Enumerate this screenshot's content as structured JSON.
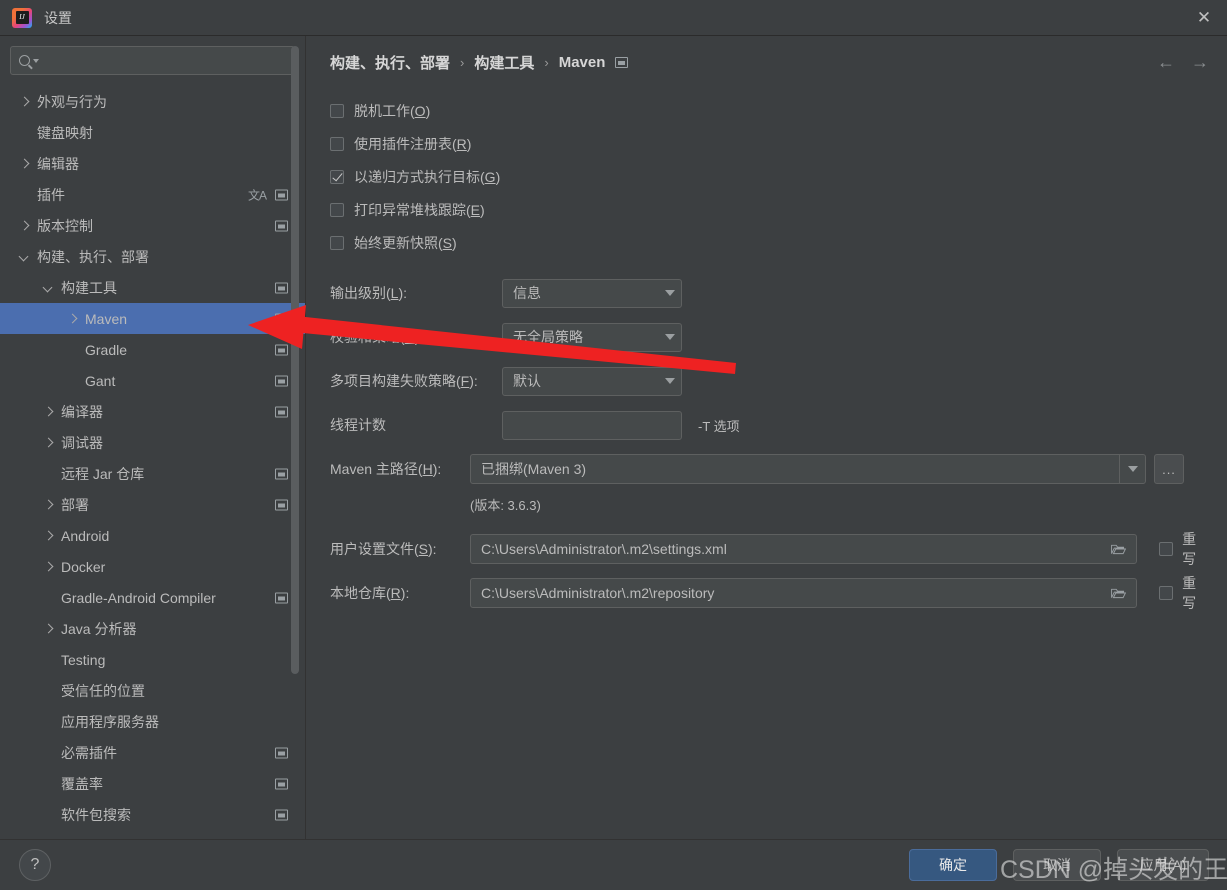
{
  "window": {
    "title": "设置",
    "app_icon": "intellij-idea-icon",
    "close_label": "✕"
  },
  "search": {
    "value": "",
    "placeholder": "",
    "icon": "search-icon",
    "dropdown_icon": "chevron-down-icon"
  },
  "sidebar": {
    "items": [
      {
        "label": "外观与行为",
        "indent": 0,
        "arrow": "closed",
        "project_icon": false,
        "lang_icon": false,
        "selected": false
      },
      {
        "label": "键盘映射",
        "indent": 0,
        "arrow": "none",
        "project_icon": false,
        "lang_icon": false,
        "selected": false
      },
      {
        "label": "编辑器",
        "indent": 0,
        "arrow": "closed",
        "project_icon": false,
        "lang_icon": false,
        "selected": false
      },
      {
        "label": "插件",
        "indent": 0,
        "arrow": "none",
        "project_icon": true,
        "lang_icon": true,
        "selected": false
      },
      {
        "label": "版本控制",
        "indent": 0,
        "arrow": "closed",
        "project_icon": true,
        "lang_icon": false,
        "selected": false
      },
      {
        "label": "构建、执行、部署",
        "indent": 0,
        "arrow": "open",
        "project_icon": false,
        "lang_icon": false,
        "selected": false
      },
      {
        "label": "构建工具",
        "indent": 1,
        "arrow": "open",
        "project_icon": true,
        "lang_icon": false,
        "selected": false
      },
      {
        "label": "Maven",
        "indent": 2,
        "arrow": "closed",
        "project_icon": true,
        "lang_icon": false,
        "selected": true
      },
      {
        "label": "Gradle",
        "indent": 2,
        "arrow": "none",
        "project_icon": true,
        "lang_icon": false,
        "selected": false
      },
      {
        "label": "Gant",
        "indent": 2,
        "arrow": "none",
        "project_icon": true,
        "lang_icon": false,
        "selected": false
      },
      {
        "label": "编译器",
        "indent": 1,
        "arrow": "closed",
        "project_icon": true,
        "lang_icon": false,
        "selected": false
      },
      {
        "label": "调试器",
        "indent": 1,
        "arrow": "closed",
        "project_icon": false,
        "lang_icon": false,
        "selected": false
      },
      {
        "label": "远程 Jar 仓库",
        "indent": 1,
        "arrow": "none",
        "project_icon": true,
        "lang_icon": false,
        "selected": false
      },
      {
        "label": "部署",
        "indent": 1,
        "arrow": "closed",
        "project_icon": true,
        "lang_icon": false,
        "selected": false
      },
      {
        "label": "Android",
        "indent": 1,
        "arrow": "closed",
        "project_icon": false,
        "lang_icon": false,
        "selected": false
      },
      {
        "label": "Docker",
        "indent": 1,
        "arrow": "closed",
        "project_icon": false,
        "lang_icon": false,
        "selected": false
      },
      {
        "label": "Gradle-Android Compiler",
        "indent": 1,
        "arrow": "none",
        "project_icon": true,
        "lang_icon": false,
        "selected": false
      },
      {
        "label": "Java 分析器",
        "indent": 1,
        "arrow": "closed",
        "project_icon": false,
        "lang_icon": false,
        "selected": false
      },
      {
        "label": "Testing",
        "indent": 1,
        "arrow": "none",
        "project_icon": false,
        "lang_icon": false,
        "selected": false
      },
      {
        "label": "受信任的位置",
        "indent": 1,
        "arrow": "none",
        "project_icon": false,
        "lang_icon": false,
        "selected": false
      },
      {
        "label": "应用程序服务器",
        "indent": 1,
        "arrow": "none",
        "project_icon": false,
        "lang_icon": false,
        "selected": false
      },
      {
        "label": "必需插件",
        "indent": 1,
        "arrow": "none",
        "project_icon": true,
        "lang_icon": false,
        "selected": false
      },
      {
        "label": "覆盖率",
        "indent": 1,
        "arrow": "none",
        "project_icon": true,
        "lang_icon": false,
        "selected": false
      },
      {
        "label": "软件包搜索",
        "indent": 1,
        "arrow": "none",
        "project_icon": true,
        "lang_icon": false,
        "selected": false
      }
    ]
  },
  "content": {
    "breadcrumb": [
      {
        "label": "构建、执行、部署"
      },
      {
        "label": "构建工具"
      },
      {
        "label": "Maven"
      }
    ],
    "breadcrumb_separator": "›",
    "breadcrumb_project_icon": "project-scope-icon",
    "nav_back": "←",
    "nav_forward": "→",
    "checkboxes": [
      {
        "label": "脱机工作(",
        "mnemonic": "O",
        "label_end": ")",
        "checked": false
      },
      {
        "label": "使用插件注册表(",
        "mnemonic": "R",
        "label_end": ")",
        "checked": false
      },
      {
        "label": "以递归方式执行目标(",
        "mnemonic": "G",
        "label_end": ")",
        "checked": true
      },
      {
        "label": "打印异常堆栈跟踪(",
        "mnemonic": "E",
        "label_end": ")",
        "checked": false
      },
      {
        "label": "始终更新快照(",
        "mnemonic": "S",
        "label_end": ")",
        "checked": false
      }
    ],
    "fields": [
      {
        "label": "输出级别(",
        "mnemonic": "L",
        "label_end": "):",
        "value": "信息",
        "kind": "combo"
      },
      {
        "label": "校验和策略(",
        "mnemonic": "C",
        "label_end": "):",
        "value": "无全局策略",
        "kind": "combo"
      },
      {
        "label": "多项目构建失败策略(",
        "mnemonic": "F",
        "label_end": "):",
        "value": "默认",
        "kind": "combo"
      },
      {
        "label": "线程计数",
        "mnemonic": "",
        "label_end": "",
        "value": "",
        "kind": "text",
        "hint": "-T 选项"
      }
    ],
    "maven_home": {
      "label": "Maven 主路径(",
      "mnemonic": "H",
      "label_end": "):",
      "value": "已捆绑(Maven 3)",
      "browse_label": "...",
      "version_note": "(版本: 3.6.3)"
    },
    "paths": [
      {
        "label": "用户设置文件(",
        "mnemonic": "S",
        "label_end": "):",
        "value": "C:\\Users\\Administrator\\.m2\\settings.xml",
        "browse_icon": "folder-icon",
        "override_label": "重写",
        "override_checked": false
      },
      {
        "label": "本地仓库(",
        "mnemonic": "R",
        "label_end": "):",
        "value": "C:\\Users\\Administrator\\.m2\\repository",
        "browse_icon": "folder-icon",
        "override_label": "重写",
        "override_checked": false
      }
    ]
  },
  "footer": {
    "help_label": "?",
    "ok_label": "确定",
    "cancel_label": "取消",
    "apply_label": "应用(A)"
  },
  "annotations": {
    "watermark": "CSDN @掉头发的王富贵",
    "arrow_color": "#ee2222",
    "arrow_target": "sidebar-item-maven"
  },
  "colors": {
    "background": "#3c3f41",
    "selection": "#4b6eaf",
    "primary_button": "#365880",
    "field_background": "#45494a",
    "text": "#bbbbbb"
  }
}
